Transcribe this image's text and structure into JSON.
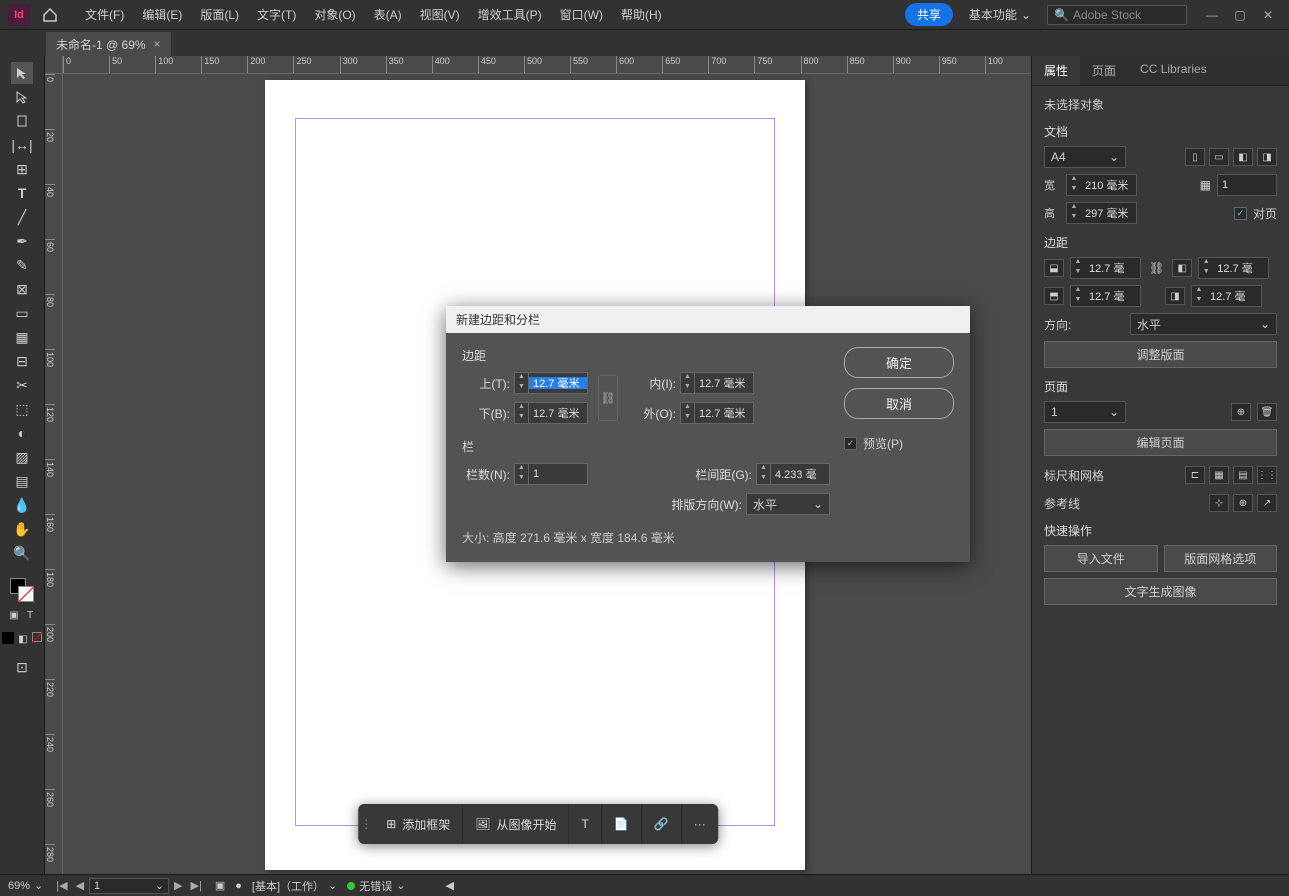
{
  "menubar": {
    "app": "Id",
    "items": [
      "文件(F)",
      "编辑(E)",
      "版面(L)",
      "文字(T)",
      "对象(O)",
      "表(A)",
      "视图(V)",
      "增效工具(P)",
      "窗口(W)",
      "帮助(H)"
    ],
    "share": "共享",
    "workspace": "基本功能",
    "search_placeholder": "Adobe Stock"
  },
  "doctab": {
    "title": "未命名-1 @ 69%",
    "close": "×"
  },
  "ruler_h": [
    "0",
    "50",
    "100",
    "150",
    "200",
    "250",
    "300",
    "350",
    "400",
    "450",
    "500",
    "550",
    "600",
    "650",
    "700",
    "750",
    "800",
    "850",
    "900",
    "950",
    "100"
  ],
  "ruler_v": [
    "0",
    "20",
    "40",
    "60",
    "80",
    "100",
    "120",
    "140",
    "160",
    "180",
    "200",
    "220",
    "240",
    "260",
    "280"
  ],
  "ctx": {
    "addframe": "添加框架",
    "fromimage": "从图像开始",
    "more": "···"
  },
  "panels": {
    "tabs": [
      "属性",
      "页面",
      "CC Libraries"
    ],
    "noSelection": "未选择对象",
    "docLabel": "文档",
    "pageSize": "A4",
    "widthLabel": "宽",
    "width": "210 毫米",
    "heightLabel": "高",
    "height": "297 毫米",
    "facingLabel": "对页",
    "marginsLabel": "边距",
    "marginVals": {
      "t": "12.7 毫",
      "b": "12.7 毫",
      "i": "12.7 毫",
      "o": "12.7 毫"
    },
    "orientLabel": "方向:",
    "orientVal": "水平",
    "adjustLayout": "调整版面",
    "pageLabel": "页面",
    "pageNum": "1",
    "editPages": "编辑页面",
    "rulerGrid": "标尺和网格",
    "guides": "参考线",
    "quickActions": "快速操作",
    "importFile": "导入文件",
    "layoutGridOptions": "版面网格选项",
    "textToImage": "文字生成图像",
    "pagesCount": "1"
  },
  "dialog": {
    "title": "新建边距和分栏",
    "margins": "边距",
    "top": "上(T):",
    "topVal": "12.7 毫米",
    "bottom": "下(B):",
    "bottomVal": "12.7 毫米",
    "inside": "内(I):",
    "insideVal": "12.7 毫米",
    "outside": "外(O):",
    "outsideVal": "12.7 毫米",
    "columns": "栏",
    "colCount": "栏数(N):",
    "colCountVal": "1",
    "gutter": "栏间距(G):",
    "gutterVal": "4.233 毫",
    "direction": "排版方向(W):",
    "directionVal": "水平",
    "size": "大小: 高度 271.6 毫米 x 宽度 184.6 毫米",
    "ok": "确定",
    "cancel": "取消",
    "preview": "预览(P)"
  },
  "status": {
    "zoom": "69%",
    "page": "1",
    "layer": "[基本]（工作）",
    "errors": "无错误"
  }
}
